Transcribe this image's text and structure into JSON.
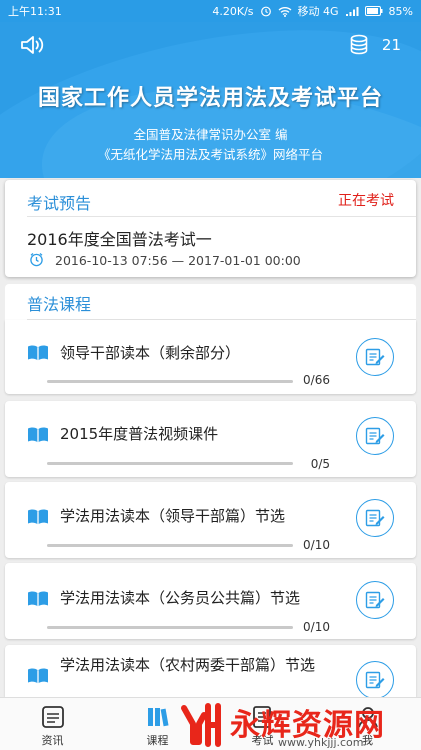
{
  "status_bar": {
    "time": "上午11:31",
    "network_speed": "4.20K/s",
    "carrier": "移动 4G",
    "battery": "85%"
  },
  "header": {
    "coin_count": "21",
    "title": "国家工作人员学法用法及考试平台",
    "subtitle_1": "全国普及法律常识办公室 编",
    "subtitle_2": "《无纸化学法用法及考试系统》网络平台"
  },
  "exam_preview": {
    "label": "考试预告",
    "status": "正在考试",
    "name": "2016年度全国普法考试一",
    "time_range": "2016-10-13 07:56 — 2017-01-01 00:00"
  },
  "courses": {
    "label": "普法课程",
    "items": [
      {
        "title": "领导干部读本（剩余部分）",
        "progress": "0/66",
        "fraction": 0
      },
      {
        "title": "2015年度普法视频课件",
        "progress": "0/5",
        "fraction": 0
      },
      {
        "title": "学法用法读本（领导干部篇）节选",
        "progress": "0/10",
        "fraction": 0
      },
      {
        "title": "学法用法读本（公务员公共篇）节选",
        "progress": "0/10",
        "fraction": 0
      },
      {
        "title": "学法用法读本（农村两委干部篇）节选",
        "progress": "",
        "fraction": 0
      }
    ]
  },
  "tabs": [
    {
      "label": "资讯",
      "icon": "news-icon"
    },
    {
      "label": "课程",
      "icon": "course-icon"
    },
    {
      "label": "考试",
      "icon": "exam-icon"
    },
    {
      "label": "我",
      "icon": "profile-icon"
    }
  ],
  "watermark": {
    "text": "永辉资源网",
    "url": "www.yhkjjj.com"
  },
  "colors": {
    "brand_blue": "#2d9de6",
    "status_red": "#e0201a"
  }
}
